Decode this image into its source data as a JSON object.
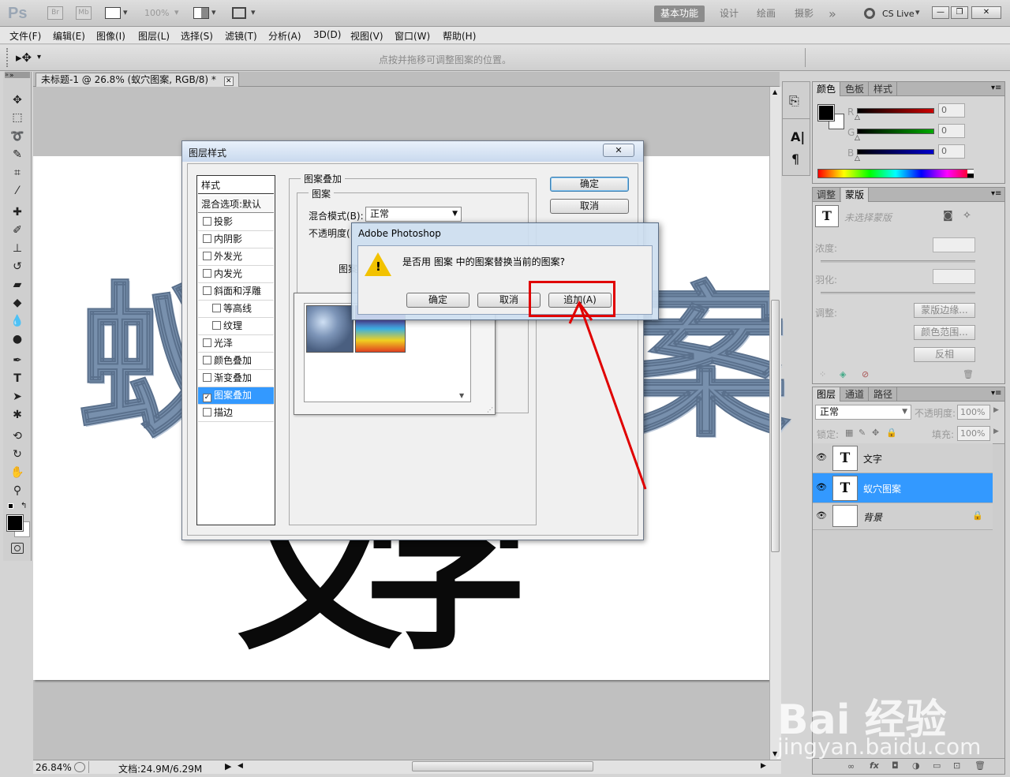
{
  "app": {
    "logo": "Ps",
    "bridge": "Br",
    "minibridge": "Mb",
    "zoom": "100%",
    "workspaces": [
      "基本功能",
      "设计",
      "绘画",
      "摄影"
    ],
    "more": "»",
    "cslive": "CS Live",
    "window_controls": [
      "minimize-icon",
      "restore-icon",
      "close-icon"
    ]
  },
  "menu": [
    "文件(F)",
    "编辑(E)",
    "图像(I)",
    "图层(L)",
    "选择(S)",
    "滤镜(T)",
    "分析(A)",
    "3D(D)",
    "视图(V)",
    "窗口(W)",
    "帮助(H)"
  ],
  "options_bar": {
    "hint": "点按并拖移可调整图案的位置。"
  },
  "document": {
    "tab_title": "未标题-1 @ 26.8% (蚁穴图案, RGB/8) *",
    "canvas_pattern_chars": [
      "蚁",
      "案"
    ],
    "canvas_black_chars": [
      "文",
      "字"
    ],
    "status_zoom": "26.84%",
    "status_doc": "文档:24.9M/6.29M"
  },
  "color_panel": {
    "tabs": [
      "颜色",
      "色板",
      "样式"
    ],
    "channels": [
      {
        "label": "R",
        "value": "0",
        "color": "#cc0000"
      },
      {
        "label": "G",
        "value": "0",
        "color": "#00aa00"
      },
      {
        "label": "B",
        "value": "0",
        "color": "#0000cc"
      }
    ]
  },
  "masks_panel": {
    "tabs": [
      "调整",
      "蒙版"
    ],
    "no_mask": "未选择蒙版",
    "density_label": "浓度:",
    "feather_label": "羽化:",
    "refine_label": "调整:",
    "buttons": [
      "蒙版边缘...",
      "颜色范围...",
      "反相"
    ]
  },
  "layers_panel": {
    "tabs": [
      "图层",
      "通道",
      "路径"
    ],
    "blend_mode": "正常",
    "opacity_label": "不透明度:",
    "opacity": "100%",
    "lock_label": "锁定:",
    "fill_label": "填充:",
    "fill": "100%",
    "layers": [
      {
        "name": "文字",
        "thumb": "T",
        "selected": false
      },
      {
        "name": "蚁穴图案",
        "thumb": "T",
        "selected": true
      },
      {
        "name": "背景",
        "thumb": "",
        "selected": false
      }
    ],
    "footer_icons": [
      "link-icon",
      "fx-icon",
      "mask-icon",
      "adjustment-icon",
      "folder-icon",
      "new-layer-icon",
      "trash-icon"
    ]
  },
  "layer_style_dialog": {
    "title": "图层样式",
    "styles_header": "样式",
    "blend_options": "混合选项:默认",
    "styles": [
      {
        "label": "投影",
        "checked": false,
        "indent": false
      },
      {
        "label": "内阴影",
        "checked": false,
        "indent": false
      },
      {
        "label": "外发光",
        "checked": false,
        "indent": false
      },
      {
        "label": "内发光",
        "checked": false,
        "indent": false
      },
      {
        "label": "斜面和浮雕",
        "checked": false,
        "indent": false
      },
      {
        "label": "等高线",
        "checked": false,
        "indent": true
      },
      {
        "label": "纹理",
        "checked": false,
        "indent": true
      },
      {
        "label": "光泽",
        "checked": false,
        "indent": false
      },
      {
        "label": "颜色叠加",
        "checked": false,
        "indent": false
      },
      {
        "label": "渐变叠加",
        "checked": false,
        "indent": false
      },
      {
        "label": "图案叠加",
        "checked": true,
        "indent": false
      },
      {
        "label": "描边",
        "checked": false,
        "indent": false
      }
    ],
    "section_title": "图案叠加",
    "group_title": "图案",
    "blend_mode_label": "混合模式(B):",
    "blend_mode_value": "正常",
    "opacity_label": "不透明度(",
    "pattern_label": "图案",
    "ok": "确定",
    "cancel": "取消"
  },
  "alert": {
    "title": "Adobe Photoshop",
    "message": "是否用 图案 中的图案替换当前的图案?",
    "buttons": [
      "确定",
      "取消",
      "追加(A)"
    ],
    "highlight_color": "#e00000"
  },
  "watermark": {
    "logo": "Bai 经验",
    "url": "jingyan.baidu.com"
  }
}
